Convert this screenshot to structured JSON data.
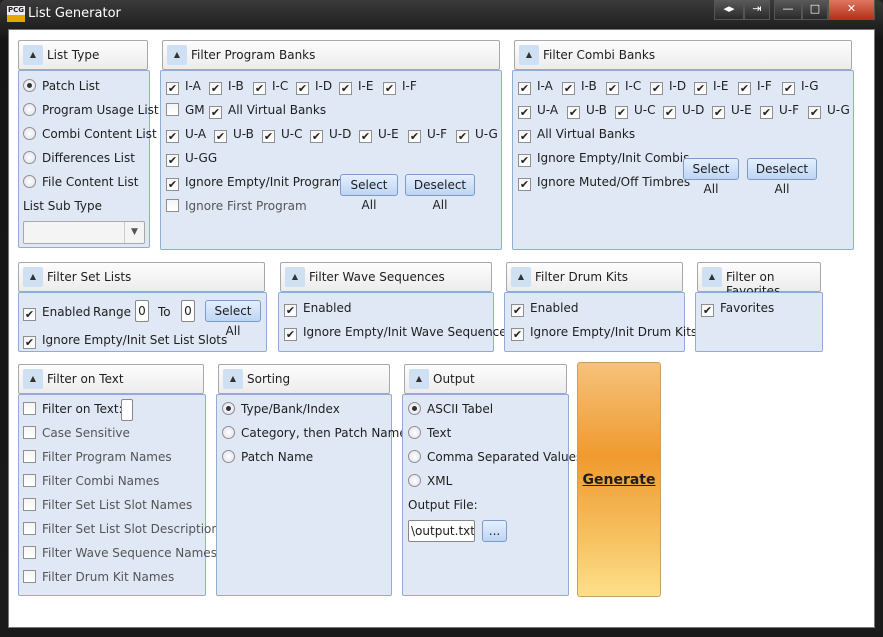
{
  "window": {
    "title": "List Generator",
    "logo": "PCG",
    "buttons": [
      "◂▸",
      "⇥",
      "—",
      "□",
      "✕"
    ]
  },
  "list_type": {
    "title": "List Type",
    "options": [
      {
        "label": "Patch List",
        "selected": true
      },
      {
        "label": "Program Usage List"
      },
      {
        "label": "Combi Content List"
      },
      {
        "label": "Differences List"
      },
      {
        "label": "File Content List"
      }
    ],
    "sub_type_label": "List Sub Type",
    "sub_type_value": ""
  },
  "program_banks": {
    "title": "Filter Program Banks",
    "items": [
      [
        "I-A",
        true
      ],
      [
        "I-B",
        true
      ],
      [
        "I-C",
        true
      ],
      [
        "I-D",
        true
      ],
      [
        "I-E",
        true
      ],
      [
        "I-F",
        true
      ],
      [
        "GM",
        false
      ],
      [
        "All Virtual Banks",
        true
      ],
      [
        "U-A",
        true
      ],
      [
        "U-B",
        true
      ],
      [
        "U-C",
        true
      ],
      [
        "U-D",
        true
      ],
      [
        "U-E",
        true
      ],
      [
        "U-F",
        true
      ],
      [
        "U-G",
        true
      ],
      [
        "U-GG",
        true
      ],
      [
        "Ignore Empty/Init Programs",
        true
      ],
      [
        "Ignore First Program",
        false
      ]
    ],
    "select_all": "Select All",
    "deselect_all": "Deselect All"
  },
  "combi_banks": {
    "title": "Filter Combi Banks",
    "items": [
      [
        "I-A",
        true
      ],
      [
        "I-B",
        true
      ],
      [
        "I-C",
        true
      ],
      [
        "I-D",
        true
      ],
      [
        "I-E",
        true
      ],
      [
        "I-F",
        true
      ],
      [
        "I-G",
        true
      ],
      [
        "U-A",
        true
      ],
      [
        "U-B",
        true
      ],
      [
        "U-C",
        true
      ],
      [
        "U-D",
        true
      ],
      [
        "U-E",
        true
      ],
      [
        "U-F",
        true
      ],
      [
        "U-G",
        true
      ],
      [
        "All Virtual Banks",
        true
      ],
      [
        "Ignore Empty/Init Combis",
        true
      ],
      [
        "Ignore Muted/Off Timbres",
        true
      ]
    ],
    "select_all": "Select All",
    "deselect_all": "Deselect All"
  },
  "set_lists": {
    "title": "Filter Set Lists",
    "enabled": "Enabled",
    "range": "Range",
    "from": "0",
    "to_label": "To",
    "to": "0",
    "select_all": "Select All",
    "ignore": "Ignore Empty/Init Set List Slots"
  },
  "wave_sequences": {
    "title": "Filter Wave Sequences",
    "enabled": "Enabled",
    "ignore": "Ignore Empty/Init Wave Sequences"
  },
  "drum_kits": {
    "title": "Filter Drum Kits",
    "enabled": "Enabled",
    "ignore": "Ignore Empty/Init Drum Kits"
  },
  "favorites": {
    "title": "Filter on Favorites",
    "label": "Favorites"
  },
  "text_filter": {
    "title": "Filter on Text",
    "items": [
      "Filter on Text:",
      "Case Sensitive",
      "Filter Program Names",
      "Filter Combi Names",
      "Filter Set List Slot Names",
      "Filter Set List Slot Descriptions",
      "Filter Wave Sequence Names",
      "Filter Drum Kit Names"
    ],
    "value": ""
  },
  "sorting": {
    "title": "Sorting",
    "options": [
      "Type/Bank/Index",
      "Category, then Patch Name",
      "Patch Name"
    ]
  },
  "output": {
    "title": "Output",
    "options": [
      "ASCII Tabel",
      "Text",
      "Comma Separated Values",
      "XML"
    ],
    "file_label": "Output File:",
    "file_value": "\\output.txt",
    "browse": "..."
  },
  "generate": "Generate"
}
